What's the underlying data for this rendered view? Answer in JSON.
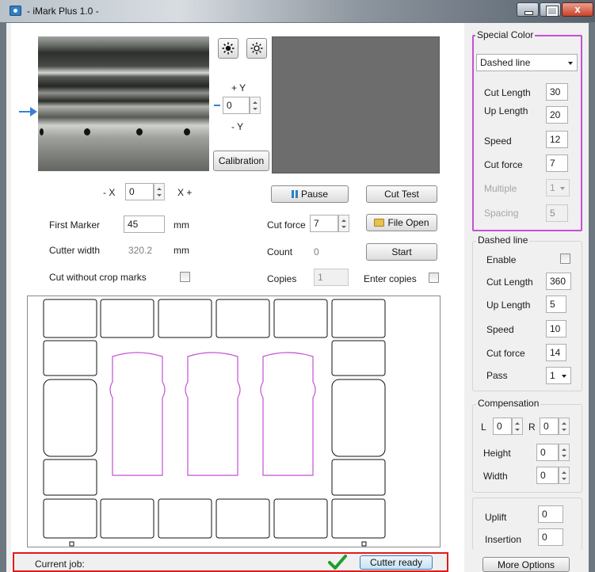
{
  "window": {
    "title": "- iMark Plus 1.0 -",
    "close_glyph": "x"
  },
  "camera": {
    "plus_y": "+ Y",
    "minus_y": "- Y",
    "y_offset": "0",
    "calibration_label": "Calibration",
    "minus_x": "- X",
    "plus_x": "X +",
    "x_offset": "0"
  },
  "settings": {
    "first_marker_label": "First Marker",
    "first_marker_value": "45",
    "unit_mm": "mm",
    "cutter_width_label": "Cutter width",
    "cutter_width_value": "320.2",
    "cut_without_crop_label": "Cut without crop marks"
  },
  "controls": {
    "pause_label": "Pause",
    "cut_test_label": "Cut Test",
    "cut_force_label": "Cut force",
    "cut_force_value": "7",
    "file_open_label": "File Open",
    "count_label": "Count",
    "count_value": "0",
    "start_label": "Start",
    "copies_label": "Copies",
    "copies_value": "1",
    "enter_copies_label": "Enter copies"
  },
  "status": {
    "current_job_label": "Current job:",
    "cutter_ready_label": "Cutter ready"
  },
  "special_color": {
    "title": "Special Color",
    "mode": "Dashed line",
    "cut_length_label": "Cut Length",
    "cut_length_value": "30",
    "up_length_label": "Up Length",
    "up_length_value": "20",
    "speed_label": "Speed",
    "speed_value": "12",
    "cut_force_label": "Cut force",
    "cut_force_value": "7",
    "multiple_label": "Multiple",
    "multiple_value": "1",
    "spacing_label": "Spacing",
    "spacing_value": "5"
  },
  "dashed_line": {
    "title": "Dashed line",
    "enable_label": "Enable",
    "cut_length_label": "Cut Length",
    "cut_length_value": "360",
    "up_length_label": "Up Length",
    "up_length_value": "5",
    "speed_label": "Speed",
    "speed_value": "10",
    "cut_force_label": "Cut force",
    "cut_force_value": "14",
    "pass_label": "Pass",
    "pass_value": "1"
  },
  "compensation": {
    "title": "Compensation",
    "l_label": "L",
    "l_value": "0",
    "r_label": "R",
    "r_value": "0",
    "height_label": "Height",
    "height_value": "0",
    "width_label": "Width",
    "width_value": "0"
  },
  "uplift": {
    "label": "Uplift",
    "value": "0"
  },
  "insertion": {
    "label": "Insertion",
    "value": "0"
  },
  "more_options_label": "More Options",
  "colors": {
    "accent_magenta": "#c451d4",
    "status_red": "#e01b1b",
    "ready_green": "#1f9e2a",
    "arrow_blue": "#3b7fd6"
  }
}
